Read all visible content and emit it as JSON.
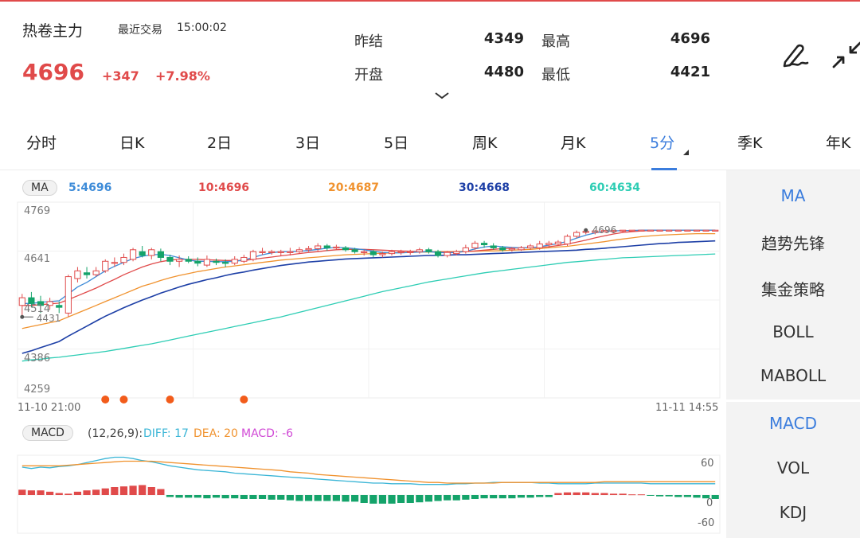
{
  "header": {
    "title": "热卷主力",
    "recent_label": "最近交易",
    "time": "15:00:02",
    "price": "4696",
    "change": "+347",
    "change_pct": "+7.98%",
    "prev_settle_label": "昨结",
    "prev_settle": "4349",
    "open_label": "开盘",
    "open": "4480",
    "high_label": "最高",
    "high": "4696",
    "low_label": "最低",
    "low": "4421"
  },
  "tabs": [
    {
      "label": "分时"
    },
    {
      "label": "日K"
    },
    {
      "label": "2日"
    },
    {
      "label": "3日"
    },
    {
      "label": "5日"
    },
    {
      "label": "周K"
    },
    {
      "label": "月K"
    },
    {
      "label": "5分",
      "active": true
    },
    {
      "label": "季K"
    },
    {
      "label": "年K"
    }
  ],
  "ma_bar": {
    "pill": "MA",
    "ma5": "5:4696",
    "ma10": "10:4696",
    "ma20": "20:4687",
    "ma30": "30:4668",
    "ma60": "60:4634",
    "colors": {
      "ma5": "#3d8bd8",
      "ma10": "#e04a4a",
      "ma20": "#f0922e",
      "ma30": "#1d3fa6",
      "ma60": "#2dcdb4"
    }
  },
  "price_axis": [
    "4769",
    "4641",
    "4514",
    "4386",
    "4259"
  ],
  "annotations": {
    "high_label": "4696",
    "low_label": "4431"
  },
  "time_axis": {
    "start": "11-10 21:00",
    "end": "11-11 14:55"
  },
  "macd_bar": {
    "pill": "MACD",
    "params": "(12,26,9):",
    "diff": "DIFF: 17",
    "dea": "DEA: 20",
    "macd": "MACD: -6",
    "axis": [
      "60",
      "0",
      "-60"
    ]
  },
  "side_menu": {
    "main": [
      {
        "label": "MA",
        "active": true
      },
      {
        "label": "趋势先锋"
      },
      {
        "label": "集金策略"
      },
      {
        "label": "BOLL"
      },
      {
        "label": "MABOLL"
      }
    ],
    "sub": [
      {
        "label": "MACD",
        "active": true
      },
      {
        "label": "VOL"
      },
      {
        "label": "KDJ"
      }
    ]
  },
  "chart_data": {
    "type": "candlestick",
    "ylim": [
      4259,
      4769
    ],
    "candles": [
      [
        4500,
        4520,
        4530,
        4470
      ],
      [
        4520,
        4505,
        4535,
        4495
      ],
      [
        4510,
        4500,
        4525,
        4480
      ],
      [
        4500,
        4510,
        4520,
        4490
      ],
      [
        4500,
        4495,
        4510,
        4480
      ],
      [
        4480,
        4575,
        4580,
        4470
      ],
      [
        4570,
        4590,
        4600,
        4560
      ],
      [
        4585,
        4580,
        4600,
        4570
      ],
      [
        4580,
        4590,
        4600,
        4575
      ],
      [
        4590,
        4615,
        4620,
        4585
      ],
      [
        4610,
        4612,
        4625,
        4600
      ],
      [
        4612,
        4625,
        4635,
        4605
      ],
      [
        4620,
        4645,
        4650,
        4615
      ],
      [
        4640,
        4630,
        4655,
        4625
      ],
      [
        4630,
        4645,
        4650,
        4620
      ],
      [
        4640,
        4625,
        4648,
        4615
      ],
      [
        4625,
        4615,
        4632,
        4605
      ],
      [
        4615,
        4620,
        4630,
        4600
      ],
      [
        4620,
        4615,
        4628,
        4610
      ],
      [
        4615,
        4610,
        4625,
        4602
      ],
      [
        4605,
        4620,
        4630,
        4600
      ],
      [
        4615,
        4612,
        4622,
        4605
      ],
      [
        4612,
        4610,
        4620,
        4600
      ],
      [
        4610,
        4620,
        4628,
        4605
      ],
      [
        4615,
        4625,
        4632,
        4610
      ],
      [
        4620,
        4640,
        4645,
        4615
      ],
      [
        4640,
        4640,
        4650,
        4632
      ],
      [
        4638,
        4640,
        4645,
        4632
      ],
      [
        4638,
        4640,
        4645,
        4630
      ],
      [
        4640,
        4640,
        4650,
        4630
      ],
      [
        4640,
        4645,
        4652,
        4635
      ],
      [
        4645,
        4648,
        4655,
        4640
      ],
      [
        4648,
        4655,
        4662,
        4640
      ],
      [
        4655,
        4650,
        4660,
        4642
      ],
      [
        4650,
        4652,
        4658,
        4645
      ],
      [
        4650,
        4645,
        4655,
        4640
      ],
      [
        4645,
        4640,
        4650,
        4635
      ],
      [
        4640,
        4640,
        4645,
        4630
      ],
      [
        4640,
        4632,
        4645,
        4625
      ],
      [
        4632,
        4635,
        4640,
        4625
      ],
      [
        4635,
        4640,
        4645,
        4630
      ],
      [
        4640,
        4640,
        4645,
        4632
      ],
      [
        4638,
        4640,
        4645,
        4632
      ],
      [
        4640,
        4645,
        4650,
        4635
      ],
      [
        4645,
        4640,
        4650,
        4635
      ],
      [
        4640,
        4630,
        4645,
        4625
      ],
      [
        4630,
        4638,
        4642,
        4625
      ],
      [
        4635,
        4640,
        4645,
        4630
      ],
      [
        4640,
        4650,
        4658,
        4635
      ],
      [
        4650,
        4662,
        4668,
        4645
      ],
      [
        4662,
        4658,
        4668,
        4650
      ],
      [
        4655,
        4650,
        4662,
        4645
      ],
      [
        4650,
        4645,
        4655,
        4640
      ],
      [
        4645,
        4648,
        4652,
        4640
      ],
      [
        4645,
        4650,
        4655,
        4642
      ],
      [
        4650,
        4655,
        4660,
        4645
      ],
      [
        4650,
        4660,
        4668,
        4645
      ],
      [
        4658,
        4662,
        4668,
        4650
      ],
      [
        4660,
        4665,
        4670,
        4655
      ],
      [
        4660,
        4680,
        4685,
        4655
      ],
      [
        4680,
        4690,
        4695,
        4675
      ],
      [
        4690,
        4693,
        4696,
        4685
      ],
      [
        4690,
        4694,
        4696,
        4685
      ],
      [
        4692,
        4695,
        4696,
        4690
      ],
      [
        4694,
        4695,
        4696,
        4690
      ],
      [
        4694,
        4696,
        4696,
        4690
      ],
      [
        4695,
        4696,
        4696,
        4693
      ],
      [
        4696,
        4696,
        4696,
        4694
      ],
      [
        4696,
        4696,
        4696,
        4695
      ],
      [
        4696,
        4696,
        4696,
        4695
      ],
      [
        4696,
        4696,
        4696,
        4696
      ],
      [
        4696,
        4696,
        4696,
        4696
      ],
      [
        4696,
        4696,
        4696,
        4696
      ],
      [
        4696,
        4696,
        4696,
        4696
      ],
      [
        4696,
        4696,
        4696,
        4696
      ],
      [
        4696,
        4696,
        4696,
        4696
      ]
    ],
    "ma": {
      "ma5": [
        4505,
        4505,
        4508,
        4510,
        4512,
        4530,
        4548,
        4560,
        4575,
        4590,
        4602,
        4612,
        4622,
        4628,
        4632,
        4633,
        4630,
        4624,
        4618,
        4615,
        4615,
        4614,
        4614,
        4615,
        4618,
        4625,
        4632,
        4637,
        4640,
        4640,
        4641,
        4643,
        4646,
        4649,
        4651,
        4650,
        4648,
        4645,
        4641,
        4638,
        4637,
        4637,
        4638,
        4639,
        4640,
        4638,
        4637,
        4638,
        4641,
        4647,
        4652,
        4655,
        4653,
        4651,
        4650,
        4650,
        4653,
        4657,
        4661,
        4667,
        4675,
        4683,
        4689,
        4693,
        4694,
        4695,
        4695,
        4696,
        4696,
        4696,
        4696,
        4696,
        4696,
        4696,
        4696,
        4696
      ],
      "ma10": [
        4500,
        4500,
        4502,
        4504,
        4506,
        4515,
        4525,
        4535,
        4545,
        4557,
        4568,
        4580,
        4590,
        4600,
        4608,
        4614,
        4618,
        4620,
        4620,
        4620,
        4619,
        4618,
        4617,
        4617,
        4617,
        4620,
        4623,
        4626,
        4629,
        4632,
        4635,
        4638,
        4640,
        4643,
        4645,
        4646,
        4646,
        4646,
        4645,
        4644,
        4643,
        4642,
        4641,
        4640,
        4640,
        4639,
        4639,
        4639,
        4640,
        4642,
        4644,
        4646,
        4648,
        4649,
        4650,
        4650,
        4651,
        4653,
        4656,
        4660,
        4665,
        4670,
        4676,
        4681,
        4686,
        4690,
        4692,
        4694,
        4695,
        4696,
        4696,
        4696,
        4696,
        4696,
        4696,
        4696
      ],
      "ma20": [
        4440,
        4445,
        4450,
        4455,
        4460,
        4470,
        4480,
        4490,
        4500,
        4510,
        4520,
        4530,
        4540,
        4550,
        4557,
        4565,
        4572,
        4578,
        4583,
        4588,
        4592,
        4596,
        4600,
        4603,
        4606,
        4609,
        4612,
        4615,
        4618,
        4620,
        4622,
        4624,
        4626,
        4628,
        4630,
        4632,
        4633,
        4634,
        4635,
        4636,
        4637,
        4638,
        4638,
        4639,
        4639,
        4640,
        4640,
        4640,
        4641,
        4641,
        4642,
        4642,
        4643,
        4644,
        4645,
        4646,
        4648,
        4650,
        4652,
        4654,
        4657,
        4660,
        4663,
        4666,
        4670,
        4673,
        4676,
        4679,
        4681,
        4683,
        4684,
        4685,
        4686,
        4687,
        4687,
        4687
      ],
      "ma30": [
        4375,
        4382,
        4390,
        4398,
        4406,
        4420,
        4433,
        4446,
        4459,
        4472,
        4483,
        4494,
        4504,
        4514,
        4523,
        4532,
        4540,
        4548,
        4555,
        4561,
        4567,
        4572,
        4578,
        4583,
        4587,
        4592,
        4596,
        4600,
        4604,
        4607,
        4610,
        4613,
        4615,
        4617,
        4619,
        4621,
        4622,
        4623,
        4624,
        4625,
        4626,
        4627,
        4628,
        4629,
        4630,
        4630,
        4631,
        4632,
        4632,
        4633,
        4634,
        4635,
        4636,
        4637,
        4638,
        4639,
        4640,
        4641,
        4642,
        4643,
        4644,
        4646,
        4647,
        4649,
        4651,
        4653,
        4655,
        4657,
        4659,
        4661,
        4662,
        4664,
        4665,
        4666,
        4667,
        4668
      ],
      "ma60": [
        4355,
        4358,
        4360,
        4363,
        4365,
        4368,
        4371,
        4374,
        4377,
        4380,
        4384,
        4388,
        4392,
        4396,
        4400,
        4405,
        4410,
        4415,
        4420,
        4425,
        4430,
        4435,
        4440,
        4445,
        4450,
        4455,
        4460,
        4465,
        4470,
        4476,
        4482,
        4488,
        4494,
        4500,
        4506,
        4512,
        4518,
        4524,
        4530,
        4536,
        4541,
        4546,
        4551,
        4556,
        4561,
        4565,
        4569,
        4573,
        4577,
        4581,
        4585,
        4588,
        4591,
        4594,
        4597,
        4600,
        4603,
        4606,
        4609,
        4612,
        4614,
        4616,
        4618,
        4620,
        4622,
        4624,
        4625,
        4626,
        4627,
        4628,
        4629,
        4630,
        4631,
        4632,
        4633,
        4634
      ]
    },
    "signal_points": [
      9,
      11,
      16,
      24
    ],
    "macd": {
      "ylim": [
        -60,
        60
      ],
      "diff": [
        42,
        40,
        42,
        41,
        43,
        44,
        46,
        49,
        52,
        55,
        57,
        57,
        55,
        52,
        50,
        47,
        44,
        42,
        40,
        38,
        37,
        36,
        35,
        33,
        32,
        31,
        30,
        29,
        28,
        27,
        26,
        25,
        24,
        23,
        22,
        21,
        20,
        19,
        18,
        18,
        17,
        17,
        17,
        16,
        16,
        16,
        16,
        17,
        17,
        18,
        18,
        19,
        19,
        19,
        19,
        19,
        18,
        18,
        17,
        17,
        17,
        17,
        18,
        18,
        18,
        18,
        18,
        18,
        17,
        17,
        17,
        17,
        17,
        17,
        17,
        17
      ],
      "dea": [
        44,
        44,
        44,
        44,
        44,
        45,
        46,
        47,
        48,
        49,
        50,
        51,
        51,
        51,
        51,
        50,
        49,
        48,
        47,
        46,
        45,
        44,
        43,
        42,
        41,
        40,
        39,
        38,
        37,
        35,
        34,
        33,
        31,
        30,
        29,
        28,
        27,
        26,
        25,
        24,
        23,
        22,
        21,
        20,
        19,
        19,
        18,
        18,
        18,
        18,
        18,
        18,
        19,
        19,
        19,
        19,
        19,
        19,
        19,
        19,
        19,
        19,
        19,
        20,
        20,
        20,
        20,
        20,
        20,
        20,
        20,
        20,
        20,
        20,
        20,
        20
      ],
      "hist": [
        8,
        7,
        7,
        5,
        3,
        2,
        5,
        7,
        8,
        10,
        12,
        13,
        14,
        15,
        12,
        9,
        -3,
        -4,
        -4,
        -4,
        -5,
        -4,
        -5,
        -5,
        -6,
        -6,
        -6,
        -7,
        -7,
        -8,
        -9,
        -9,
        -9,
        -9,
        -9,
        -10,
        -10,
        -12,
        -13,
        -13,
        -13,
        -12,
        -12,
        -11,
        -10,
        -9,
        -8,
        -8,
        -7,
        -6,
        -5,
        -5,
        -5,
        -5,
        -4,
        -4,
        -3,
        -3,
        3,
        4,
        4,
        4,
        3,
        3,
        2,
        2,
        1,
        1,
        -1,
        -2,
        -2,
        -3,
        -3,
        -4,
        -5,
        -6
      ]
    }
  }
}
